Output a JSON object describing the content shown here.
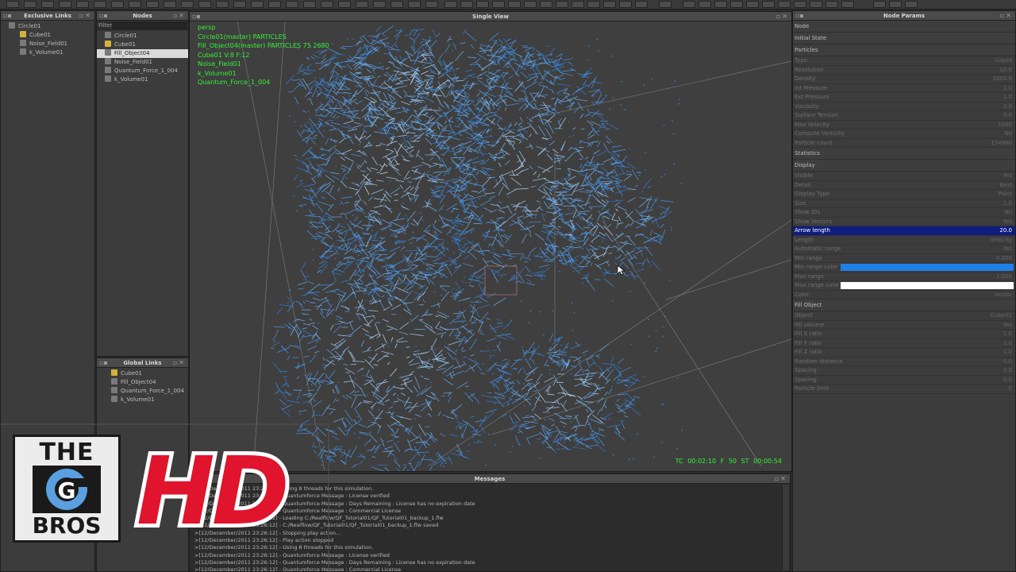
{
  "panels": {
    "exclusive_links": {
      "title": "Exclusive Links",
      "items": [
        "Circle01",
        "Cube01",
        "Noise_Field01",
        "k_Volume01"
      ]
    },
    "nodes": {
      "title": "Nodes",
      "filter_label": "Filter",
      "items": [
        "Circle01",
        "Cube01",
        "Fill_Object04",
        "Noise_Field01",
        "Quantum_Force_1_004",
        "k_Volume01"
      ],
      "selected_index": 2
    },
    "global_links": {
      "title": "Global Links",
      "items": [
        "Cube01",
        "Fill_Object04",
        "Quantum_Force_1_004",
        "k_Volume01"
      ]
    }
  },
  "viewport": {
    "title": "Single View",
    "hud": [
      "persp",
      "Circle01(master) PARTICLES",
      "Fill_Object04(master) PARTICLES 75 2680",
      "Cube01 V:8 F:12",
      "Noise_Field01",
      "k_Volume01",
      "Quantum_Force_1_004"
    ],
    "timecode": "TC 00:02:10   F 50   ST 00:00:54"
  },
  "node_params": {
    "title": "Node Params",
    "sections": [
      {
        "label": "Node",
        "rows": []
      },
      {
        "label": "Initial State",
        "rows": []
      },
      {
        "label": "Particles",
        "rows": [
          {
            "key": "Type",
            "value": "Liquid"
          },
          {
            "key": "Resolution",
            "value": "10.0"
          },
          {
            "key": "Density",
            "value": "1000.0"
          },
          {
            "key": "Int Pressure",
            "value": "1.0"
          },
          {
            "key": "Ext Pressure",
            "value": "1.0"
          },
          {
            "key": "Viscosity",
            "value": "0.0"
          },
          {
            "key": "Surface Tension",
            "value": "0.0"
          },
          {
            "key": "Max Velocity",
            "value": "1000"
          },
          {
            "key": "Compute Vorticity",
            "value": "No"
          },
          {
            "key": "Particle count",
            "value": "154960"
          }
        ]
      },
      {
        "label": "Statistics",
        "rows": []
      },
      {
        "label": "Display",
        "rows": [
          {
            "key": "Visible",
            "value": "Yes"
          },
          {
            "key": "Detail",
            "value": "Best"
          },
          {
            "key": "Display Type",
            "value": "Point"
          },
          {
            "key": "Size",
            "value": "1.0"
          },
          {
            "key": "Show IDs",
            "value": "No"
          },
          {
            "key": "Show Vectors",
            "value": "Yes"
          },
          {
            "key": "Arrow length",
            "value": "20.0",
            "active": true
          },
          {
            "key": "Length",
            "value": "Velocity"
          },
          {
            "key": "Automatic range",
            "value": "Yes"
          },
          {
            "key": "Min range",
            "value": "0.000"
          },
          {
            "key": "Min range color",
            "value": "",
            "swatch": "#1e7fe6"
          },
          {
            "key": "Max range",
            "value": "1.000"
          },
          {
            "key": "Max range color",
            "value": "",
            "swatch": "#ffffff"
          },
          {
            "key": "Color",
            "value": "Vector"
          }
        ]
      },
      {
        "label": "Fill Object",
        "rows": [
          {
            "key": "Object",
            "value": "Cube01"
          },
          {
            "key": "Fill volume",
            "value": "Yes"
          },
          {
            "key": "Fill X ratio",
            "value": "1.0"
          },
          {
            "key": "Fill Y ratio",
            "value": "1.0"
          },
          {
            "key": "Fill Z ratio",
            "value": "1.0"
          },
          {
            "key": "Random distance",
            "value": "0.0"
          },
          {
            "key": "Spacing",
            "value": "0.0"
          },
          {
            "key": "Spacing",
            "value": "0.0"
          },
          {
            "key": "Particle limit",
            "value": "0"
          }
        ]
      }
    ]
  },
  "messages": {
    "title": "Messages",
    "lines": [
      ">[12/December/2011 23:26:12] - Using 8 threads for this simulation.",
      ">[12/December/2011 23:26:12] - Quantumforce Message : License verified",
      ">[12/December/2011 23:26:12] - Quantumforce Message : Days Remaining : License has no expiration date",
      ">[12/December/2011 23:26:12] - Quantumforce Message : Commercial License",
      ">[12/December/2011 23:26:12] - Loading C:/Realflow/QF_Tutorial01/QF_Tutorial01_backup_1.flw",
      ">[12/December/2011 23:26:12] - C:/Realflow/QF_Tutorial01/QF_Tutorial01_backup_1.flw saved",
      ">[12/December/2011 23:26:12] - Stopping play action...",
      ">[12/December/2011 23:26:12] - Play action stopped",
      ">[12/December/2011 23:26:12] - Using 8 threads for this simulation.",
      ">[12/December/2011 23:26:12] - Quantumforce Message : License verified",
      ">[12/December/2011 23:26:12] - Quantumforce Message : Days Remaining : License has no expiration date",
      ">[12/December/2011 23:26:12] - Quantumforce Message : Commercial License"
    ]
  },
  "logo": {
    "the": "THE",
    "g": "G",
    "bros": "BROS",
    "hd": "HD"
  },
  "colors": {
    "hud_green": "#34f234",
    "particle_blue": "#3a8fe8",
    "hd_red": "#e0142c",
    "selection_blue": "#0f1d7e"
  }
}
